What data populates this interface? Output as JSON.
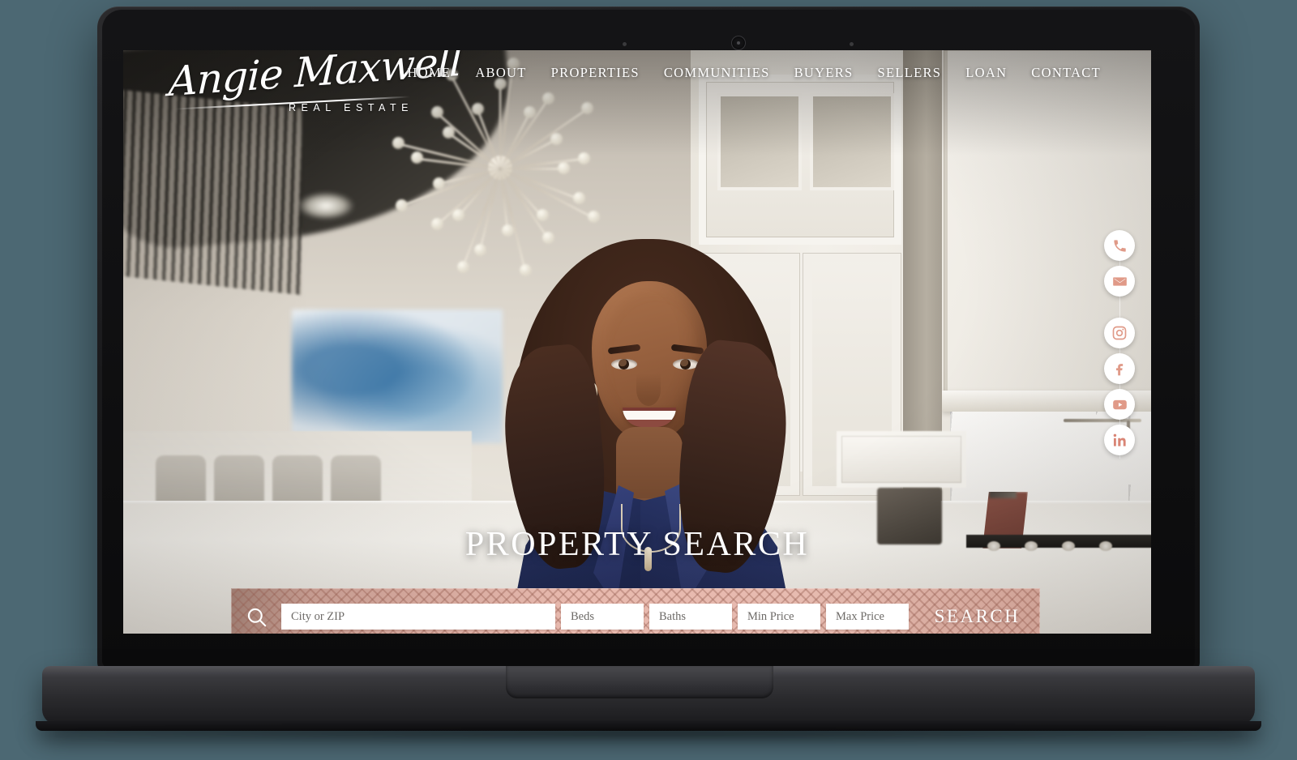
{
  "device": {
    "type": "laptop-mockup",
    "background_color": "#4c6873",
    "camera_icon": "camera-icon"
  },
  "site": {
    "logo": {
      "script_text": "Angie Maxwell",
      "subtitle": "REAL ESTATE"
    },
    "nav": [
      {
        "label": "HOME"
      },
      {
        "label": "ABOUT"
      },
      {
        "label": "PROPERTIES"
      },
      {
        "label": "COMMUNITIES"
      },
      {
        "label": "BUYERS"
      },
      {
        "label": "SELLERS"
      },
      {
        "label": "LOAN"
      },
      {
        "label": "CONTACT"
      }
    ],
    "hero": {
      "title": "PROPERTY SEARCH"
    },
    "search": {
      "icon": "search-icon",
      "city_placeholder": "City or ZIP",
      "city_value": "",
      "beds_placeholder": "Beds",
      "beds_value": "",
      "baths_placeholder": "Baths",
      "baths_value": "",
      "min_price_placeholder": "Min Price",
      "min_price_value": "",
      "max_price_placeholder": "Max Price",
      "max_price_value": "",
      "button_label": "SEARCH",
      "bar_color": "#e8b9ae"
    },
    "social": {
      "icon_color": "#e09a88",
      "items": [
        {
          "name": "phone-icon",
          "label": "Phone"
        },
        {
          "name": "email-icon",
          "label": "Email"
        },
        {
          "name": "instagram-icon",
          "label": "Instagram"
        },
        {
          "name": "facebook-icon",
          "label": "Facebook"
        },
        {
          "name": "youtube-icon",
          "label": "YouTube"
        },
        {
          "name": "linkedin-icon",
          "label": "LinkedIn"
        }
      ]
    },
    "hero_image": {
      "description": "Real estate agent smiling in a bright white kitchen",
      "blazer_color": "#232c5b"
    }
  }
}
